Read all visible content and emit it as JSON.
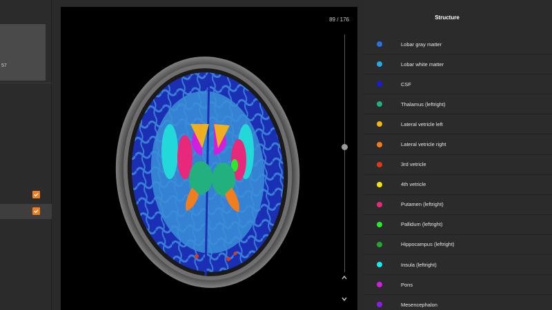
{
  "left_panel": {
    "card_value": "57",
    "checkbox_1_checked": true,
    "checkbox_2_checked": true
  },
  "viewer": {
    "slice_counter": "89 / 176",
    "slider_position_fraction": 0.5
  },
  "structures": {
    "header": "Structure",
    "items": [
      {
        "label": "Lobar gray matter",
        "color": "#2f6fe0"
      },
      {
        "label": "Lobar white matter",
        "color": "#2aa8e6"
      },
      {
        "label": "CSF",
        "color": "#1a1ad8"
      },
      {
        "label": "Thalamus (leftright)",
        "color": "#22b07e"
      },
      {
        "label": "Lateral vetricle left",
        "color": "#f2b418"
      },
      {
        "label": "Lateral vetricle right",
        "color": "#f07d1e"
      },
      {
        "label": "3rd vetricle",
        "color": "#d93a18"
      },
      {
        "label": "4th vetricle",
        "color": "#f2e21a"
      },
      {
        "label": "Putamen (leftright)",
        "color": "#e8287a"
      },
      {
        "label": "Pallidum (leftright)",
        "color": "#2ee82e"
      },
      {
        "label": "Hippocampus (leftright)",
        "color": "#24a82c"
      },
      {
        "label": "Insula (leftright)",
        "color": "#1ee8e8"
      },
      {
        "label": "Pons",
        "color": "#d21ee0"
      },
      {
        "label": "Mesencephalon",
        "color": "#8a1ee8"
      }
    ]
  },
  "icons": {
    "check": "check-icon",
    "up": "chevron-up-icon",
    "down": "chevron-down-icon"
  }
}
